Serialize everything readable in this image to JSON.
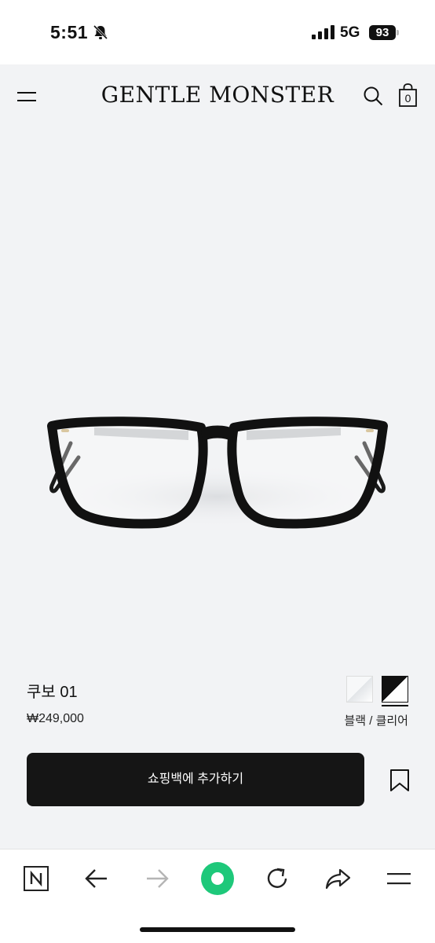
{
  "status_bar": {
    "time": "5:51",
    "network": "5G",
    "battery": "93",
    "icons": [
      "bell-slash-icon",
      "signal-icon",
      "battery-icon"
    ]
  },
  "header": {
    "brand": "GENTLE MONSTER",
    "bag_count": "0",
    "icons": [
      "menu-icon",
      "search-icon",
      "shopping-bag-icon"
    ]
  },
  "product": {
    "image": "black-eyeglasses",
    "pager": {
      "pages": 4,
      "active_index": 0
    },
    "name": "쿠보 01",
    "price": "₩249,000",
    "color_label": "블랙 / 클리어",
    "swatches": [
      {
        "name": "clear",
        "selected": false
      },
      {
        "name": "black-clear",
        "selected": true
      }
    ],
    "add_to_bag_label": "쇼핑백에 추가하기",
    "accent": "#151515"
  },
  "browser_toolbar": {
    "icons": [
      "naver-n-icon",
      "back-arrow-icon",
      "forward-arrow-icon",
      "green-dot-home-icon",
      "reload-icon",
      "share-icon",
      "hamburger-menu-icon"
    ],
    "accent": "#1ec800"
  }
}
